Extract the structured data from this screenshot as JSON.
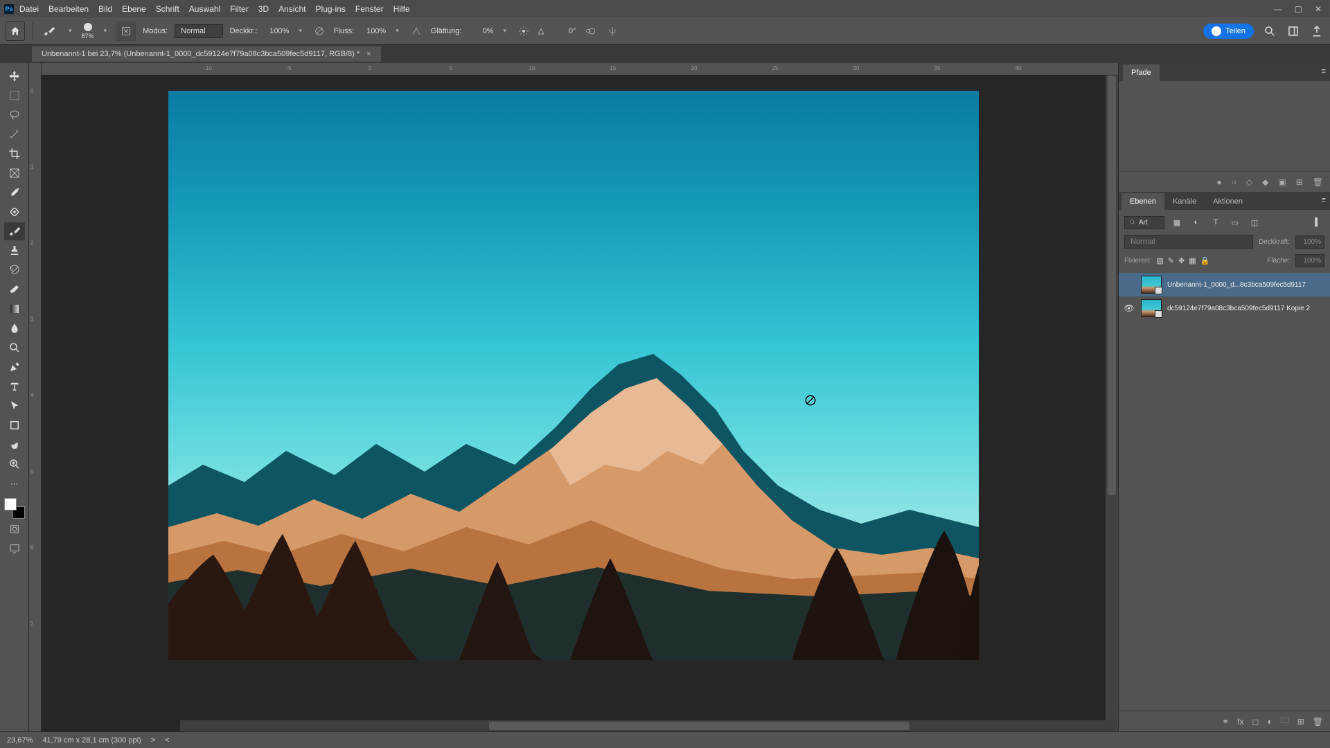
{
  "menu": {
    "datei": "Datei",
    "bearbeiten": "Bearbeiten",
    "bild": "Bild",
    "ebene": "Ebene",
    "schrift": "Schrift",
    "auswahl": "Auswahl",
    "filter": "Filter",
    "dd": "3D",
    "ansicht": "Ansicht",
    "plugins": "Plug-ins",
    "fenster": "Fenster",
    "hilfe": "Hilfe"
  },
  "options": {
    "brush_size": "87%",
    "modus_lbl": "Modus:",
    "modus_val": "Normal",
    "deck_lbl": "Deckkr.:",
    "deck_val": "100%",
    "fluss_lbl": "Fluss:",
    "fluss_val": "100%",
    "glatt_lbl": "Glättung:",
    "glatt_val": "0%",
    "angle_lbl": "△",
    "angle_val": "0°",
    "share": "Teilen"
  },
  "tab": {
    "title": "Unbenannt-1 bei 23,7% (Unbenannt-1_0000_dc59124e7f79a08c3bca509fec5d9117, RGB/8) *"
  },
  "hruler": [
    "-10",
    "-5",
    "0",
    "5",
    "10",
    "15",
    "20",
    "25",
    "30",
    "35",
    "40"
  ],
  "vruler": [
    "0",
    "1",
    "2",
    "3",
    "4",
    "5",
    "6",
    "7"
  ],
  "panels": {
    "pfade": "Pfade",
    "ebenen": "Ebenen",
    "kanaele": "Kanäle",
    "aktionen": "Aktionen",
    "kind": "Art",
    "blend": "Normal",
    "deck_lbl": "Deckkraft:",
    "deck_val": "100%",
    "fix_lbl": "Fixieren:",
    "fill_lbl": "Fläche:",
    "fill_val": "100%"
  },
  "layers": [
    {
      "visible": false,
      "name": "Unbenannt-1_0000_d...8c3bca509fec5d9117",
      "selected": true
    },
    {
      "visible": true,
      "name": "dc59124e7f79a08c3bca509fec5d9117 Kopie 2",
      "selected": false
    }
  ],
  "status": {
    "zoom": "23,67%",
    "dims": "41,79 cm x 28,1 cm (300 ppi)"
  }
}
